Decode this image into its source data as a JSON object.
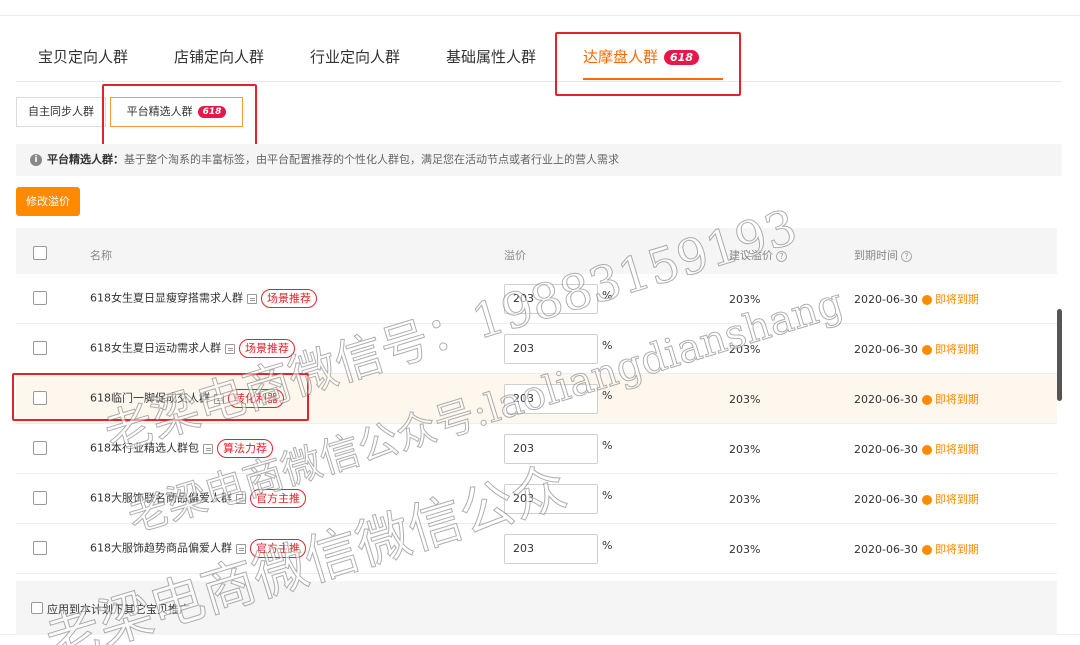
{
  "tabs": [
    {
      "label": "宝贝定向人群"
    },
    {
      "label": "店铺定向人群"
    },
    {
      "label": "行业定向人群"
    },
    {
      "label": "基础属性人群"
    },
    {
      "label": "达摩盘人群",
      "badge": "618"
    }
  ],
  "subtabs": [
    {
      "label": "自主同步人群"
    },
    {
      "label": "平台精选人群",
      "badge": "618"
    }
  ],
  "info": {
    "icon": "info-icon",
    "title": "平台精选人群：",
    "text": "基于整个淘系的丰富标签，由平台配置推荐的个性化人群包，满足您在活动节点或者行业上的营人需求"
  },
  "modify_button": "修改溢价",
  "table": {
    "headers": {
      "name": "名称",
      "price": "溢价",
      "suggest": "建议溢价",
      "expire": "到期时间"
    },
    "rows": [
      {
        "name": "618女生夏日显瘦穿搭需求人群",
        "tag": "场景推荐",
        "price": "203",
        "unit": "%",
        "suggest": "203%",
        "date": "2020-06-30",
        "status": "即将到期"
      },
      {
        "name": "618女生夏日运动需求人群",
        "tag": "场景推荐",
        "price": "203",
        "unit": "%",
        "suggest": "203%",
        "date": "2020-06-30",
        "status": "即将到期"
      },
      {
        "name": "618临门一脚促成交人群",
        "tag": "转化利器",
        "price": "203",
        "unit": "%",
        "suggest": "203%",
        "date": "2020-06-30",
        "status": "即将到期"
      },
      {
        "name": "618本行业精选人群包",
        "tag": "算法力荐",
        "price": "203",
        "unit": "%",
        "suggest": "203%",
        "date": "2020-06-30",
        "status": "即将到期"
      },
      {
        "name": "618大服饰联名商品偏爱人群",
        "tag": "官方主推",
        "price": "203",
        "unit": "%",
        "suggest": "203%",
        "date": "2020-06-30",
        "status": "即将到期"
      },
      {
        "name": "618大服饰趋势商品偏爱人群",
        "tag": "官方主推",
        "price": "203",
        "unit": "%",
        "suggest": "203%",
        "date": "2020-06-30",
        "status": "即将到期"
      }
    ]
  },
  "footer": {
    "apply_label": "应用到本计划下其它宝贝推广"
  },
  "watermarks": {
    "line1": "老梁电商微信号：19883159193",
    "line2": "老梁电商微信公众号:laoliangdianshang",
    "line3": "老梁电商微信微信公众"
  },
  "colors": {
    "accent": "#ff6a00",
    "tag_red": "#e4222a",
    "badge": "#e8174a"
  }
}
